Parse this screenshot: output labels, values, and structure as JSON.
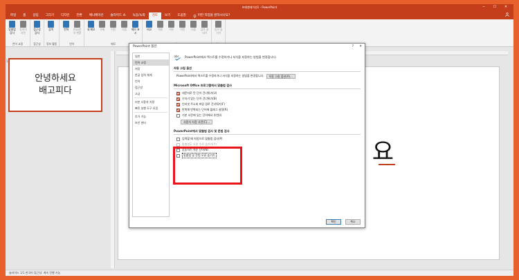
{
  "window": {
    "title": "프레젠테이션1 - PowerPoint",
    "controls": {
      "minimize": "─",
      "maximize": "☐",
      "close": "✕"
    }
  },
  "tabs": [
    {
      "label": "파일"
    },
    {
      "label": "홈"
    },
    {
      "label": "삽입"
    },
    {
      "label": "그리기"
    },
    {
      "label": "디자인"
    },
    {
      "label": "전환"
    },
    {
      "label": "애니메이션"
    },
    {
      "label": "슬라이드 쇼"
    },
    {
      "label": "녹음/녹화"
    },
    {
      "label": "검토"
    },
    {
      "label": "보기"
    },
    {
      "label": "도움말"
    }
  ],
  "tell_me": "어떤 작업을 원하시나요?",
  "ribbon": {
    "groups": [
      {
        "label": "언어 교정",
        "buttons": [
          {
            "label": "맞춤법 검사",
            "color": "#2e75b6"
          },
          {
            "label": "동의어 사전",
            "color": "#7f7f7f",
            "dim": true
          }
        ]
      },
      {
        "label": "접근성",
        "buttons": [
          {
            "label": "접근성 검사",
            "color": "#2e75b6"
          }
        ]
      },
      {
        "label": "정보 활용",
        "buttons": [
          {
            "label": "검색",
            "color": "#2e75b6"
          }
        ]
      },
      {
        "label": "언어",
        "buttons": [
          {
            "label": "번역",
            "color": "#2e75b6"
          },
          {
            "label": "한글/한자 변환",
            "color": "#7f7f7f",
            "dim": true
          }
        ]
      },
      {
        "label": "메모",
        "buttons": [
          {
            "label": "새 메모",
            "color": "#2e75b6"
          },
          {
            "label": "삭제",
            "color": "#7f7f7f",
            "dim": true
          },
          {
            "label": "이전",
            "color": "#7f7f7f",
            "dim": true
          },
          {
            "label": "다음",
            "color": "#7f7f7f",
            "dim": true
          },
          {
            "label": "메모 표시",
            "color": "#2e75b6"
          }
        ]
      },
      {
        "label": "비교",
        "buttons": [
          {
            "label": "비교",
            "color": "#2e75b6"
          },
          {
            "label": "적용",
            "color": "#7f7f7f",
            "dim": true
          },
          {
            "label": "거부",
            "color": "#7f7f7f",
            "dim": true
          },
          {
            "label": "이전",
            "color": "#7f7f7f",
            "dim": true
          },
          {
            "label": "다음",
            "color": "#7f7f7f",
            "dim": true
          },
          {
            "label": "검토 끝내기",
            "color": "#7f7f7f",
            "dim": true
          }
        ]
      },
      {
        "label": "잉크",
        "buttons": [
          {
            "label": "잉크 숨기기",
            "color": "#7f7f7f",
            "dim": true
          }
        ]
      }
    ]
  },
  "thumbnail": {
    "number": "1",
    "line1": "안녕하세요",
    "line2": "배고피다"
  },
  "slide": {
    "big_text": "요"
  },
  "status": "슬라이드 1/1   한국어   접근성: 계속 진행 가능",
  "dialog": {
    "title": "PowerPoint 옵션",
    "help": "?",
    "close": "✕",
    "nav": [
      "일반",
      "언어 교정",
      "저장",
      "한글 입력 체계",
      "언어",
      "접근성",
      "고급",
      "리본 사용자 지정",
      "빠른 실행 도구 모음",
      "추가 기능",
      "보안 센터"
    ],
    "intro": "PowerPoint에서 텍스트를 수정하거나 서식을 지정하는 방법을 변경합니다.",
    "autocorrect": {
      "title": "자동 고침 옵션",
      "desc": "PowerPoint에서 텍스트를 수정하거나 서식을 지정하는 방법을 변경합니다.",
      "button": "자동 고침 옵션(A)..."
    },
    "office": {
      "title": "Microsoft Office 프로그램에서 맞춤법 검사",
      "items": [
        {
          "label": "대문자로 된 단어 건너뛰기(U)",
          "checked": true
        },
        {
          "label": "숫자가 있는 단어 건너뛰기(B)",
          "checked": true
        },
        {
          "label": "인터넷 주소와 파일 경로 건너뛰기(F)",
          "checked": true
        },
        {
          "label": "반복해 반복되는 단어에 플래그 설정(R)",
          "checked": true
        },
        {
          "label": "기본 사전에 있는 단어에서 추천(I)",
          "checked": false
        }
      ],
      "button": "사용자 지정 사전(C)..."
    },
    "ppt": {
      "title": "PowerPoint에서 맞춤법 검사 및 문법 검사",
      "items": [
        {
          "label": "입력할 때 자동으로 맞춤법 검사(P)",
          "checked": false,
          "disabled": false
        },
        {
          "label": "맞춤법도 오류 수로 숨기기(Y)",
          "checked": false,
          "disabled": true
        },
        {
          "label": "혼동하기 쉬운 단어(N)",
          "checked": false,
          "disabled": false
        },
        {
          "label": "맞춤법 및 문법 오류 숨기기",
          "checked": false,
          "disabled": false,
          "focus": true
        }
      ]
    },
    "ok": "확인",
    "cancel": "취소"
  },
  "colors": {
    "accent": "#c43e1c",
    "border": "#e8602c",
    "highlight": "#e8141a"
  }
}
